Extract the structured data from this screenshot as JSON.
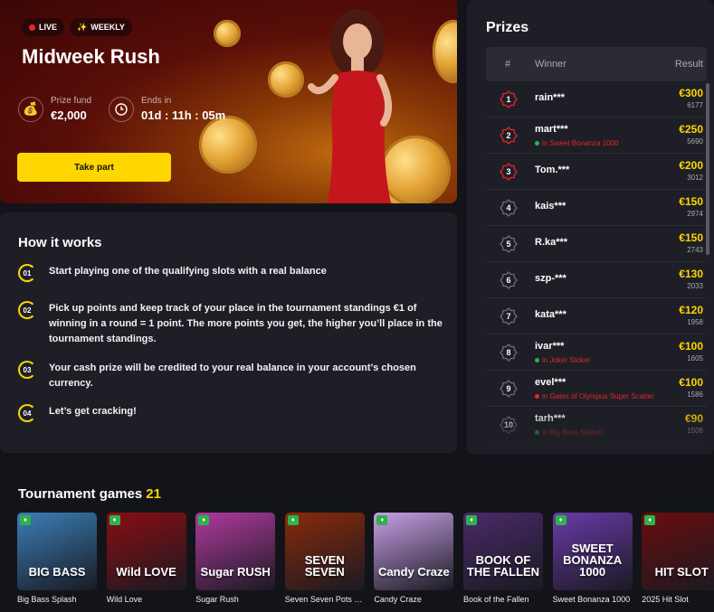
{
  "hero": {
    "badge_live": "LIVE",
    "badge_weekly": "WEEKLY",
    "title": "Midweek Rush",
    "prize_label": "Prize fund",
    "prize_value": "€2,000",
    "ends_label": "Ends in",
    "ends_value": "01d : 11h : 05m",
    "cta": "Take part",
    "icons": {
      "live": "live-dot-icon",
      "weekly": "sparkle-icon",
      "prize": "money-bag-icon",
      "ends": "clock-icon"
    },
    "colors": {
      "accent": "#ffd600",
      "bg": "#5a0e08"
    }
  },
  "how": {
    "title": "How it works",
    "steps": [
      {
        "num": "01",
        "text": "Start playing one of the qualifying slots with a real balance"
      },
      {
        "num": "02",
        "text": "Pick up points and keep track of your place in the tournament standings €1 of winning in a round = 1 point. The more points you get, the higher you’ll place in the tournament standings."
      },
      {
        "num": "03",
        "text": "Your cash prize will be credited to your real balance in your account’s chosen currency."
      },
      {
        "num": "04",
        "text": "Let’s get cracking!"
      }
    ]
  },
  "prizes": {
    "title": "Prizes",
    "col_place": "#",
    "col_winner": "Winner",
    "col_result": "Result",
    "rows": [
      {
        "place": "1",
        "name": "rain***",
        "game": "",
        "amount": "€300",
        "points": "6177"
      },
      {
        "place": "2",
        "name": "mart***",
        "game": "in Sweet Bonanza 1000",
        "amount": "€250",
        "points": "5690"
      },
      {
        "place": "3",
        "name": "Tom.***",
        "game": "",
        "amount": "€200",
        "points": "3012"
      },
      {
        "place": "4",
        "name": "kais***",
        "game": "",
        "amount": "€150",
        "points": "2974"
      },
      {
        "place": "5",
        "name": "R.ka***",
        "game": "",
        "amount": "€150",
        "points": "2743"
      },
      {
        "place": "6",
        "name": "szp-***",
        "game": "",
        "amount": "€130",
        "points": "2033"
      },
      {
        "place": "7",
        "name": "kata***",
        "game": "",
        "amount": "€120",
        "points": "1958"
      },
      {
        "place": "8",
        "name": "ivar***",
        "game": "in Joker Stoker",
        "amount": "€100",
        "points": "1605"
      },
      {
        "place": "9",
        "name": "evel***",
        "game": "in Gates of Olympus Super Scatter",
        "amount": "€100",
        "points": "1586"
      },
      {
        "place": "10",
        "name": "tarh***",
        "game": "in Big Bass Splash",
        "amount": "€90",
        "points": "1508"
      }
    ]
  },
  "games": {
    "title": "Tournament games",
    "count": "21",
    "items": [
      {
        "name": "Big Bass Splash",
        "art": "BIG BASS",
        "bg": "#3a7fb8"
      },
      {
        "name": "Wild Love",
        "art": "Wild LOVE",
        "bg": "#8a0d12"
      },
      {
        "name": "Sugar Rush",
        "art": "Sugar RUSH",
        "bg": "#b03a9e"
      },
      {
        "name": "Seven Seven Pots and Pearls",
        "art": "SEVEN SEVEN",
        "bg": "#8a2a0a"
      },
      {
        "name": "Candy Craze",
        "art": "Candy Craze",
        "bg": "#c8a0e6"
      },
      {
        "name": "Book of the Fallen",
        "art": "BOOK OF THE FALLEN",
        "bg": "#4a2a6a"
      },
      {
        "name": "Sweet Bonanza 1000",
        "art": "SWEET BONANZA 1000",
        "bg": "#6a3aa8"
      },
      {
        "name": "2025 Hit Slot",
        "art": "HIT SLOT",
        "bg": "#6a0c0c"
      }
    ]
  }
}
